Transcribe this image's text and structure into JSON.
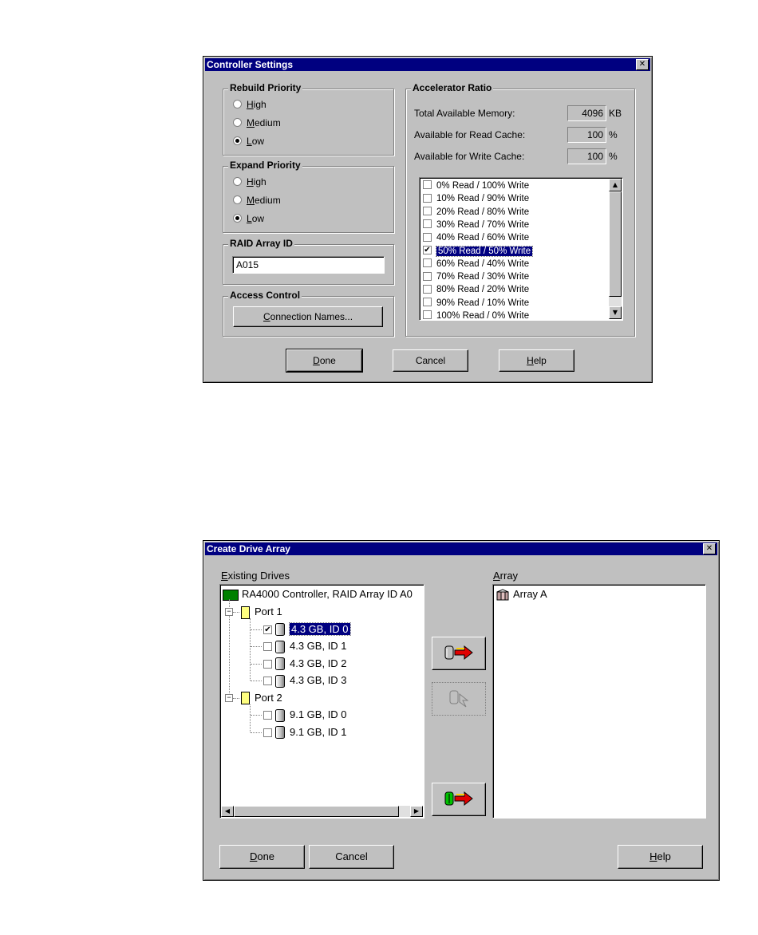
{
  "controller_settings": {
    "title": "Controller Settings",
    "close_glyph": "✕",
    "rebuild_priority": {
      "title": "Rebuild Priority",
      "options": [
        {
          "u": "H",
          "rest": "igh",
          "checked": false
        },
        {
          "u": "M",
          "rest": "edium",
          "checked": false
        },
        {
          "u": "L",
          "rest": "ow",
          "checked": true
        }
      ]
    },
    "expand_priority": {
      "title": "Expand Priority",
      "options": [
        {
          "u": "H",
          "rest": "igh",
          "checked": false
        },
        {
          "u": "M",
          "rest": "edium",
          "checked": false
        },
        {
          "u": "L",
          "rest": "ow",
          "checked": true
        }
      ]
    },
    "raid_array_id": {
      "title": "RAID Array ID",
      "value": "A015"
    },
    "access_control": {
      "title": "Access Control",
      "button_u": "C",
      "button_rest": "onnection Names..."
    },
    "accelerator_ratio": {
      "title": "Accelerator Ratio",
      "total_memory_label": "Total Available Memory:",
      "total_memory_value": "4096",
      "total_memory_unit": "KB",
      "read_cache_label": "Available for Read Cache:",
      "read_cache_value": "100",
      "read_cache_unit": "%",
      "write_cache_label": "Available for Write Cache:",
      "write_cache_value": "100",
      "write_cache_unit": "%",
      "ratios": [
        {
          "label": "0% Read / 100% Write",
          "checked": false
        },
        {
          "label": "10% Read / 90% Write",
          "checked": false
        },
        {
          "label": "20% Read / 80% Write",
          "checked": false
        },
        {
          "label": "30% Read / 70% Write",
          "checked": false
        },
        {
          "label": "40% Read / 60% Write",
          "checked": false
        },
        {
          "label": "50% Read / 50% Write",
          "checked": true
        },
        {
          "label": "60% Read / 40% Write",
          "checked": false
        },
        {
          "label": "70% Read / 30% Write",
          "checked": false
        },
        {
          "label": "80% Read / 20% Write",
          "checked": false
        },
        {
          "label": "90% Read / 10% Write",
          "checked": false
        },
        {
          "label": "100% Read / 0% Write",
          "checked": false
        }
      ],
      "selected_index": 5
    },
    "buttons": {
      "done_u": "D",
      "done_rest": "one",
      "cancel": "Cancel",
      "help_u": "H",
      "help_rest": "elp"
    }
  },
  "create_drive_array": {
    "title": "Create Drive Array",
    "close_glyph": "✕",
    "existing_drives_u": "E",
    "existing_drives_rest": "xisting Drives",
    "array_u": "A",
    "array_rest": "rray",
    "controller": "RA4000 Controller, RAID Array ID A0",
    "ports": [
      {
        "name": "Port 1",
        "drives": [
          {
            "label": "4.3 GB, ID 0",
            "checked": true,
            "selected": true
          },
          {
            "label": "4.3 GB, ID 1",
            "checked": false,
            "selected": false
          },
          {
            "label": "4.3 GB, ID 2",
            "checked": false,
            "selected": false
          },
          {
            "label": "4.3 GB, ID 3",
            "checked": false,
            "selected": false
          }
        ]
      },
      {
        "name": "Port 2",
        "drives": [
          {
            "label": "9.1 GB, ID 0",
            "checked": false,
            "selected": false
          },
          {
            "label": "9.1 GB, ID 1",
            "checked": false,
            "selected": false
          }
        ]
      }
    ],
    "arrays": [
      "Array A"
    ],
    "buttons": {
      "done_u": "D",
      "done_rest": "one",
      "cancel": "Cancel",
      "help_u": "H",
      "help_rest": "elp"
    },
    "colors": {
      "selection": "#000080",
      "arrow": "#ff0000"
    }
  }
}
